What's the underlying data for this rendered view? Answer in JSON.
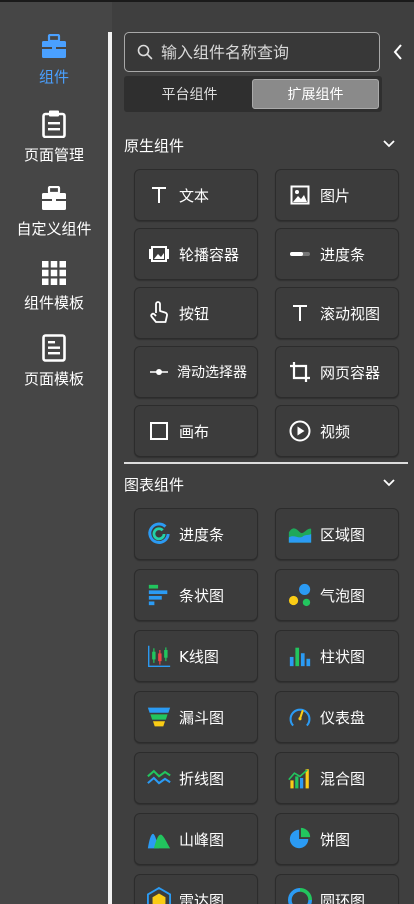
{
  "sidebar": {
    "items": [
      {
        "label": "组件",
        "icon": "briefcase-icon",
        "active": true
      },
      {
        "label": "页面管理",
        "icon": "clipboard-icon",
        "active": false
      },
      {
        "label": "自定义组件",
        "icon": "briefcase-icon",
        "active": false
      },
      {
        "label": "组件模板",
        "icon": "grid-icon",
        "active": false
      },
      {
        "label": "页面模板",
        "icon": "document-icon",
        "active": false
      }
    ]
  },
  "search": {
    "placeholder": "输入组件名称查询"
  },
  "tabs": [
    {
      "label": "平台组件",
      "active": false
    },
    {
      "label": "扩展组件",
      "active": true
    }
  ],
  "sections": {
    "native": {
      "title": "原生组件",
      "items": [
        {
          "label": "文本",
          "icon": "text-icon"
        },
        {
          "label": "图片",
          "icon": "image-icon"
        },
        {
          "label": "轮播容器",
          "icon": "carousel-icon"
        },
        {
          "label": "进度条",
          "icon": "progress-bar-icon"
        },
        {
          "label": "按钮",
          "icon": "pointer-hand-icon"
        },
        {
          "label": "滚动视图",
          "icon": "text-icon"
        },
        {
          "label": "滑动选择器",
          "icon": "slider-icon"
        },
        {
          "label": "网页容器",
          "icon": "crop-icon"
        },
        {
          "label": "画布",
          "icon": "canvas-square-icon"
        },
        {
          "label": "视频",
          "icon": "play-circle-icon"
        }
      ]
    },
    "charts": {
      "title": "图表组件",
      "items": [
        {
          "label": "进度条",
          "icon": "ring-progress-icon"
        },
        {
          "label": "区域图",
          "icon": "area-chart-icon"
        },
        {
          "label": "条状图",
          "icon": "bar-chart-horizontal-icon"
        },
        {
          "label": "气泡图",
          "icon": "bubble-chart-icon"
        },
        {
          "label": "K线图",
          "icon": "candlestick-chart-icon"
        },
        {
          "label": "柱状图",
          "icon": "column-chart-icon"
        },
        {
          "label": "漏斗图",
          "icon": "funnel-chart-icon"
        },
        {
          "label": "仪表盘",
          "icon": "gauge-icon"
        },
        {
          "label": "折线图",
          "icon": "line-chart-icon"
        },
        {
          "label": "混合图",
          "icon": "mixed-chart-icon"
        },
        {
          "label": "山峰图",
          "icon": "mountain-chart-icon"
        },
        {
          "label": "饼图",
          "icon": "pie-chart-icon"
        },
        {
          "label": "雷达图",
          "icon": "radar-chart-icon"
        },
        {
          "label": "圆环图",
          "icon": "donut-chart-icon"
        }
      ]
    }
  },
  "colors": {
    "accent": "#4aa0ff",
    "panel": "#3f3f3f",
    "sidebar": "#464646",
    "card": "#3c3c3c"
  }
}
